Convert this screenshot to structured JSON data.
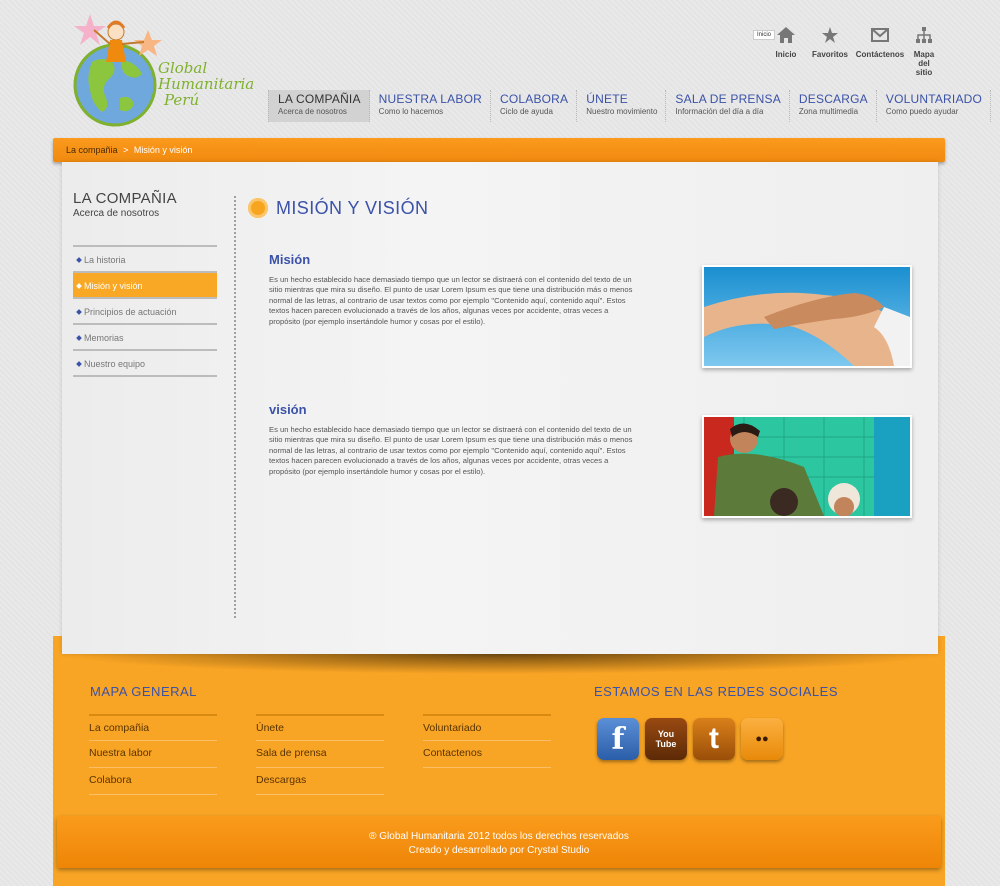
{
  "logo": {
    "line1": "Global",
    "line2": "Humanitaria",
    "line3": "Perú"
  },
  "utility": {
    "tooltip": "Inicio",
    "items": [
      {
        "label": "Inicio",
        "icon": "home-icon"
      },
      {
        "label": "Favoritos",
        "icon": "star-icon"
      },
      {
        "label": "Contáctenos",
        "icon": "mail-icon"
      },
      {
        "label": "Mapa del sitio",
        "icon": "sitemap-icon"
      }
    ]
  },
  "nav": [
    {
      "title": "LA COMPAÑIA",
      "sub": "Acerca de nosotros"
    },
    {
      "title": "NUESTRA LABOR",
      "sub": "Como lo hacemos"
    },
    {
      "title": "COLABORA",
      "sub": "Ciclo de ayuda"
    },
    {
      "title": "ÚNETE",
      "sub": "Nuestro movimiento"
    },
    {
      "title": "SALA DE PRENSA",
      "sub": "Información del día a día"
    },
    {
      "title": "DESCARGA",
      "sub": "Zona multimedia"
    },
    {
      "title": "VOLUNTARIADO",
      "sub": "Como puedo ayudar"
    }
  ],
  "breadcrumb": {
    "parent": "La compañia",
    "sep": ">",
    "current": "Misión y visión"
  },
  "sidebar": {
    "title": "LA COMPAÑIA",
    "subtitle": "Acerca de nosotros",
    "items": [
      "La historia",
      "Misión y visión",
      "Principios de actuación",
      "Memorias",
      "Nuestro equipo"
    ]
  },
  "content": {
    "title": "MISIÓN Y VISIÓN",
    "mision": {
      "heading": "Misión",
      "body": "Es un hecho establecido hace demasiado tiempo que un lector se distraerá con el contenido del texto de un sitio mientras que mira su diseño. El punto de usar Lorem Ipsum es que tiene una distribución más o menos normal de las letras, al contrario de usar textos como por ejemplo \"Contenido aquí, contenido aquí\". Estos textos hacen parecen evolucionado a través de los años, algunas veces por accidente, otras veces a propósito (por ejemplo insertándole humor y cosas por el estilo)."
    },
    "vision": {
      "heading": "visión",
      "body": "Es un hecho establecido hace demasiado tiempo que un lector se distraerá con el contenido del texto de un sitio mientras que mira su diseño. El punto de usar Lorem Ipsum es que tiene una distribución más o menos normal de las letras, al contrario de usar textos como por ejemplo \"Contenido aquí, contenido aquí\". Estos textos hacen parecen evolucionado a través de los años, algunas veces por accidente, otras veces a propósito (por ejemplo insertándole humor y cosas por el estilo)."
    }
  },
  "footer": {
    "map_title": "MAPA GENERAL",
    "social_title": "ESTAMOS EN LAS REDES SOCIALES",
    "col1": [
      "La compañia",
      "Nuestra labor",
      "Colabora"
    ],
    "col2": [
      "Únete",
      "Sala de prensa",
      "Descargas"
    ],
    "col3": [
      "Voluntariado",
      "Contactenos"
    ],
    "social": [
      {
        "name": "facebook-icon",
        "glyph": "f",
        "color": "#3b6fb6"
      },
      {
        "name": "youtube-icon",
        "glyph": "You Tube",
        "color": "#7a3a0c"
      },
      {
        "name": "twitter-icon",
        "glyph": "t",
        "color": "#b5620b"
      },
      {
        "name": "flickr-icon",
        "glyph": "●●",
        "color": "#f08a0f"
      }
    ],
    "copyright": "® Global Humanitaria 2012 todos los derechos reservados",
    "credits": "Creado y desarrollado por Crystal Studio"
  },
  "colors": {
    "accent": "#f8a424",
    "brand_blue": "#3b52a8",
    "logo_green": "#7fb12e"
  }
}
